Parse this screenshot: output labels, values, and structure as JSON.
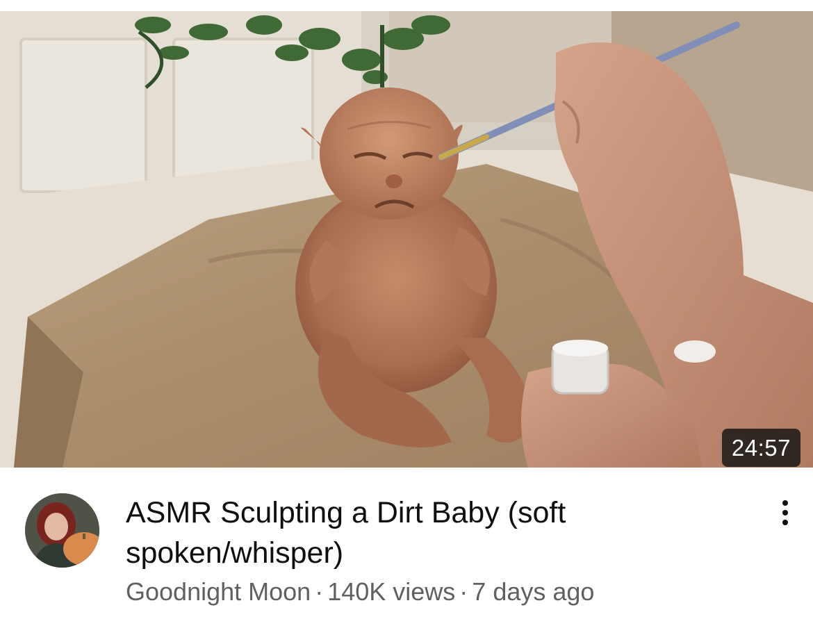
{
  "video": {
    "duration": "24:57",
    "title": "ASMR Sculpting a Dirt Baby (soft spoken/whisper)",
    "channel": "Goodnight Moon",
    "views": "140K views",
    "age": "7 days ago",
    "separator": "·"
  },
  "icons": {
    "more": "more-vert-icon",
    "avatar": "channel-avatar"
  }
}
